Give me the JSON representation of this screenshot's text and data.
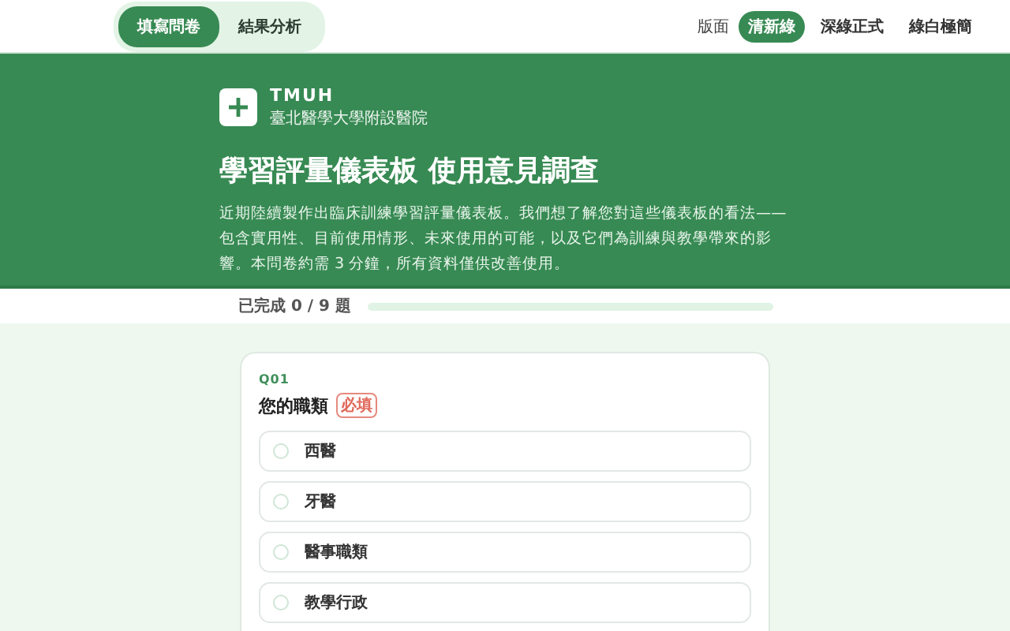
{
  "mode_tabs": [
    {
      "label": "填寫問卷",
      "selected": true
    },
    {
      "label": "結果分析",
      "selected": false
    }
  ],
  "theme_switch": {
    "label": "版面",
    "options": [
      {
        "label": "清新綠",
        "selected": true
      },
      {
        "label": "深綠正式",
        "selected": false
      },
      {
        "label": "綠白極簡",
        "selected": false
      }
    ]
  },
  "brand": {
    "name": "TMUH",
    "subtitle": "臺北醫學大學附設醫院"
  },
  "title": "學習評量儀表板 使用意見調查",
  "intro": "近期陸續製作出臨床訓練學習評量儀表板。我們想了解您對這些儀表板的看法——包含實用性、目前使用情形、未來使用的可能，以及它們為訓練與教學帶來的影響。本問卷約需 3 分鐘，所有資料僅供改善使用。",
  "progress": {
    "label": "已完成 0 / 9 題",
    "level": 0
  },
  "question": {
    "number": "Q01",
    "text": "您的職類",
    "required_badge": "必填",
    "options": [
      {
        "label": "西醫",
        "selected": false
      },
      {
        "label": "牙醫",
        "selected": false
      },
      {
        "label": "醫事職類",
        "selected": false
      },
      {
        "label": "教學行政",
        "selected": false
      }
    ]
  }
}
